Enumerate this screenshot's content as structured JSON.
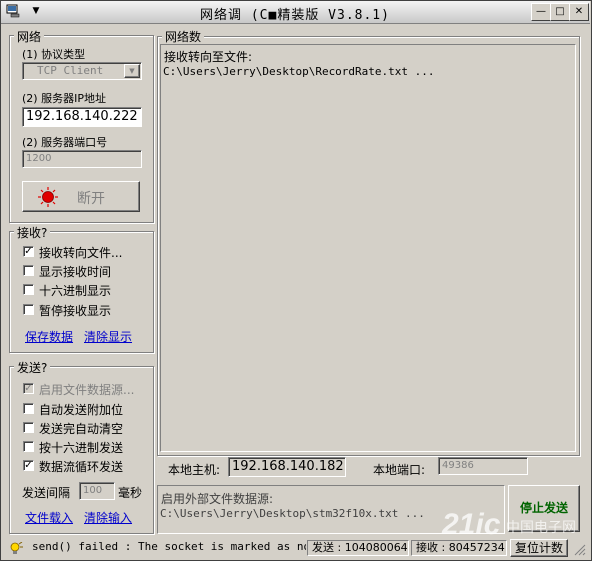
{
  "window": {
    "title": "网络调 (C■精装版 V3.8.1)",
    "menu_arrow": "▼",
    "minimize": "—",
    "maximize": "□",
    "close": "✕"
  },
  "network": {
    "group_label": "网络",
    "protocol_label": "(1) 协议类型",
    "protocol_value": "TCP Client",
    "ip_label": "(2) 服务器IP地址",
    "ip_value": "192.168.140.222",
    "port_label": "(2) 服务器端口号",
    "port_value": "1200",
    "connect_button": "断开"
  },
  "receive": {
    "group_label": "接收?",
    "options": [
      {
        "label": "接收转向文件...",
        "checked": true,
        "enabled": true
      },
      {
        "label": "显示接收时间",
        "checked": false,
        "enabled": true
      },
      {
        "label": "十六进制显示",
        "checked": false,
        "enabled": true
      },
      {
        "label": "暂停接收显示",
        "checked": false,
        "enabled": true
      }
    ],
    "save_link": "保存数据",
    "clear_link": "清除显示"
  },
  "send": {
    "group_label": "发送?",
    "options": [
      {
        "label": "启用文件数据源...",
        "checked": true,
        "enabled": false
      },
      {
        "label": "自动发送附加位",
        "checked": false,
        "enabled": true
      },
      {
        "label": "发送完自动清空",
        "checked": false,
        "enabled": true
      },
      {
        "label": "按十六进制发送",
        "checked": false,
        "enabled": true
      },
      {
        "label": "数据流循环发送",
        "checked": true,
        "enabled": true
      }
    ],
    "interval_label": "发送间隔",
    "interval_value": "100",
    "interval_unit": "毫秒",
    "load_file_link": "文件载入",
    "clear_input_link": "清除输入"
  },
  "data_area": {
    "group_label": "网络数",
    "line1": "接收转向至文件:",
    "line2": "C:\\Users\\Jerry\\Desktop\\RecordRate.txt ..."
  },
  "local": {
    "host_label": "本地主机:",
    "host_value": "192.168.140.182",
    "port_label": "本地端口:",
    "port_value": "49386"
  },
  "send_area": {
    "line1": "启用外部文件数据源:",
    "line2": "C:\\Users\\Jerry\\Desktop\\stm32f10x.txt ...",
    "stop_button": "停止发送"
  },
  "status_bar": {
    "message": "send() failed : The socket is marked as nonbl",
    "sent_label": "发送 : 104080064",
    "recv_label": "接收 : 80457234",
    "reset_button": "复位计数"
  },
  "watermark": {
    "logo": "21ic",
    "text": "中国电子网"
  },
  "colors": {
    "face": "#d4d0c8",
    "record_indicator": "#e00000",
    "stop_button_text": "#006400",
    "link": "#0000cc"
  }
}
